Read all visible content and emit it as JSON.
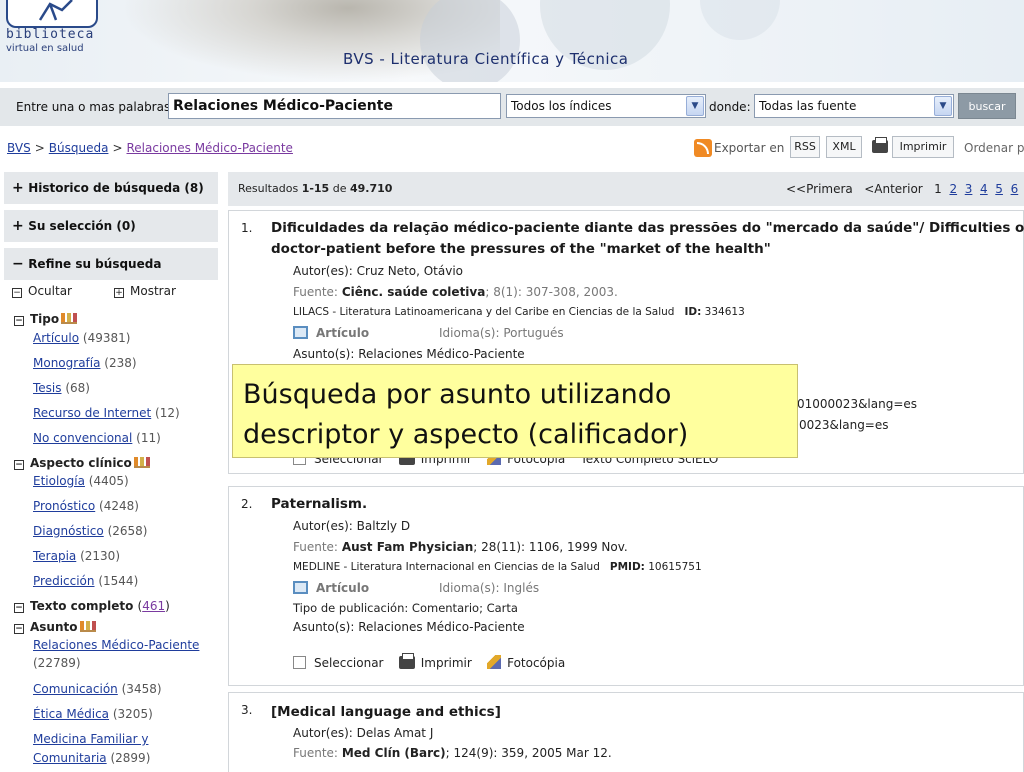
{
  "header": {
    "logo_line1": "biblioteca",
    "logo_line2": "virtual en salud",
    "title": "BVS - Literatura Científica y Técnica"
  },
  "search": {
    "label": "Entre una o mas palabras",
    "query": "Relaciones Médico-Paciente",
    "index_select": "Todos los índices",
    "where_label": "donde:",
    "source_select": "Todas las fuente",
    "button": "buscar"
  },
  "breadcrumb": [
    "BVS",
    "Búsqueda",
    "Relaciones Médico-Paciente"
  ],
  "toolbar": {
    "export_label": "Exportar en",
    "rss": "RSS",
    "xml": "XML",
    "print": "Imprimir",
    "order": "Ordenar p"
  },
  "sidebar": {
    "history": {
      "label": "Historico de búsqueda",
      "count": "(8)"
    },
    "selection": {
      "label": "Su selección",
      "count": "(0)"
    },
    "refine": {
      "label": "Refine su búsqueda"
    },
    "hide": "Ocultar",
    "show": "Mostrar",
    "tipo": {
      "label": "Tipo",
      "items": [
        {
          "label": "Artículo",
          "count": "(49381)"
        },
        {
          "label": "Monografía",
          "count": "(238)"
        },
        {
          "label": "Tesis",
          "count": "(68)"
        },
        {
          "label": "Recurso de Internet",
          "count": "(12)"
        },
        {
          "label": "No convencional",
          "count": "(11)"
        }
      ]
    },
    "aspecto": {
      "label": "Aspecto clínico",
      "items": [
        {
          "label": "Etiología",
          "count": "(4405)"
        },
        {
          "label": "Pronóstico",
          "count": "(4248)"
        },
        {
          "label": "Diagnóstico",
          "count": "(2658)"
        },
        {
          "label": "Terapia",
          "count": "(2130)"
        },
        {
          "label": "Predicción",
          "count": "(1544)"
        }
      ]
    },
    "texto": {
      "label": "Texto completo",
      "open": "(",
      "count": "461",
      "close": ")"
    },
    "asunto": {
      "label": "Asunto",
      "items": [
        {
          "label": "Relaciones Médico-Paciente",
          "count": "(22789)"
        },
        {
          "label": "Comunicación",
          "count": "(3458)"
        },
        {
          "label": "Ética Médica",
          "count": "(3205)"
        },
        {
          "label": "Medicina Familiar y",
          "label2": "Comunitaria",
          "count": "(2899)"
        }
      ]
    }
  },
  "results": {
    "summary_prefix": "Resultados",
    "range": "1-15",
    "of": "de",
    "total": "49.710",
    "pager": {
      "first": "<<Primera",
      "prev": "<Anterior",
      "current": "1",
      "pages": [
        "2",
        "3",
        "4",
        "5",
        "6"
      ]
    },
    "labels": {
      "author": "Autor(es):",
      "source": "Fuente:",
      "language": "Idioma(s):",
      "subject": "Asunto(s):",
      "pubtype": "Tipo de publicación:",
      "select": "Seleccionar",
      "print": "Imprimir",
      "photocopy": "Fotocópia",
      "fulltext": "Texto Completo SciELO",
      "article": "Artículo"
    },
    "records": [
      {
        "num": "1.",
        "title1": "Dificuldades da relação médico-paciente diante das pressões do \"mercado da saúde\"/ Difficulties of the",
        "title2": "doctor-patient before the pressures of the \"market of the health\"",
        "author": "Cruz Neto, Otávio",
        "source_journal": "Ciênc. saúde coletiva",
        "source_rest": "; 8(1): 307-308, 2003.",
        "db": "LILACS - Literatura Latinoamericana y del Caribe en Ciencias de la Salud",
        "id_label": "ID:",
        "id": "334613",
        "language": "Portugués",
        "subject": "Relaciones Médico-Paciente",
        "url1_tail": "01000023&lang=es",
        "url2_tail": "0023&lang=es"
      },
      {
        "num": "2.",
        "title1": "Paternalism.",
        "author": "Baltzly D",
        "source_journal": "Aust Fam Physician",
        "source_rest": "; 28(11): 1106, 1999 Nov.",
        "db": "MEDLINE - Literatura Internacional en Ciencias de la Salud",
        "id_label": "PMID:",
        "id": "10615751",
        "language": "Inglés",
        "pubtype": "Comentario; Carta",
        "subject": "Relaciones Médico-Paciente"
      },
      {
        "num": "3.",
        "title1": "[Medical language and ethics]",
        "author": "Delas Amat J",
        "source_journal": "Med Clín (Barc)",
        "source_rest": "; 124(9): 359, 2005 Mar 12."
      }
    ]
  },
  "callout": {
    "line1": "Búsqueda por asunto utilizando",
    "line2": "descriptor y aspecto (calificador)"
  }
}
